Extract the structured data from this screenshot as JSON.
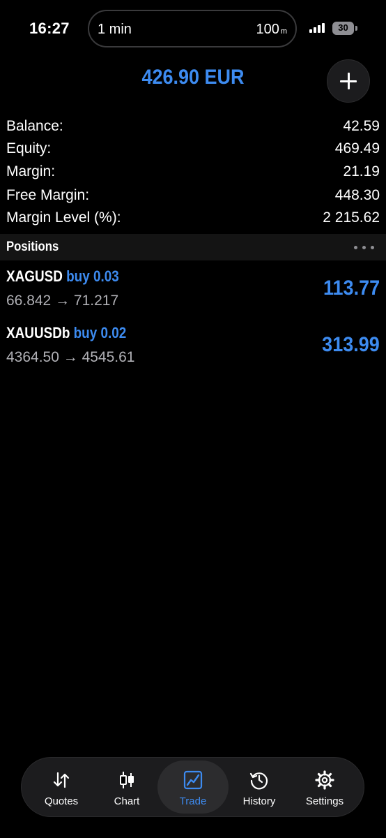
{
  "status": {
    "time": "16:27",
    "island_left": "1 min",
    "island_right": "100",
    "island_unit": "m",
    "battery": "30"
  },
  "header": {
    "account_total": "426.90 EUR",
    "add_icon": "plus-icon"
  },
  "summary": [
    {
      "label": "Balance:",
      "value": "42.59"
    },
    {
      "label": "Equity:",
      "value": "469.49"
    },
    {
      "label": "Margin:",
      "value": "21.19"
    },
    {
      "label": "Free Margin:",
      "value": "448.30"
    },
    {
      "label": "Margin Level (%):",
      "value": "2 215.62"
    }
  ],
  "positions": {
    "title": "Positions",
    "items": [
      {
        "symbol": "XAGUSD",
        "side": "buy 0.03",
        "prices": "66.842 → 71.217",
        "profit": "113.77"
      },
      {
        "symbol": "XAUUSDb",
        "side": "buy 0.02",
        "prices": "4364.50 → 4545.61",
        "profit": "313.99"
      }
    ]
  },
  "tabs": [
    {
      "label": "Quotes",
      "icon": "arrows-up-down-icon",
      "active": false
    },
    {
      "label": "Chart",
      "icon": "candlestick-icon",
      "active": false
    },
    {
      "label": "Trade",
      "icon": "trade-chart-icon",
      "active": true
    },
    {
      "label": "History",
      "icon": "history-clock-icon",
      "active": false
    },
    {
      "label": "Settings",
      "icon": "gear-icon",
      "active": false
    }
  ],
  "colors": {
    "accent": "#3d8bf0",
    "background": "#000000",
    "tabbar": "#1c1c1e"
  }
}
